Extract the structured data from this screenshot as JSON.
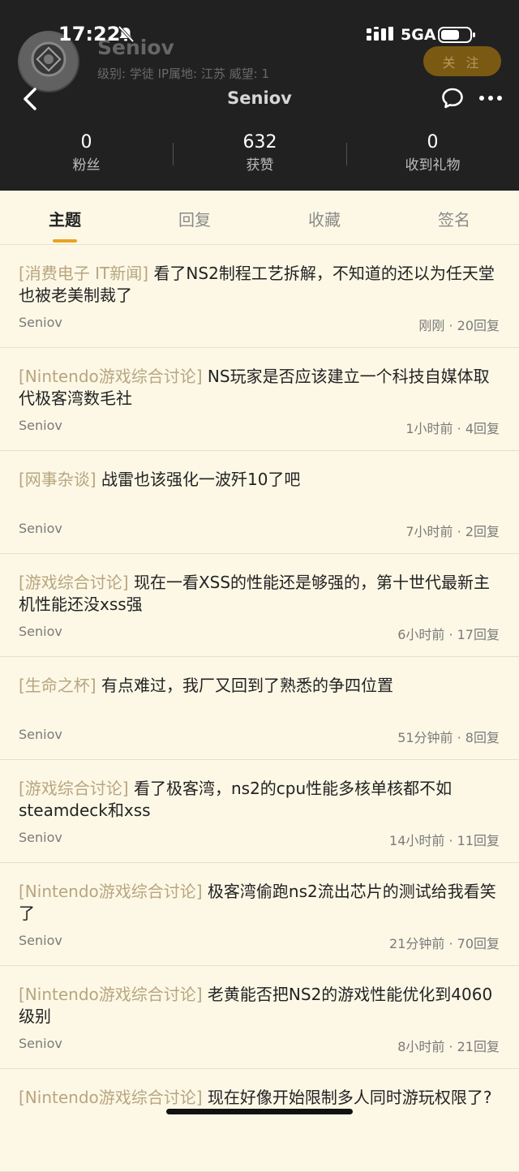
{
  "status_bar": {
    "time": "17:22",
    "network": "5GA"
  },
  "profile": {
    "name": "Seniov",
    "meta": "级别: 学徒  IP属地: 江苏  威望: 1",
    "follow_label": "关 注"
  },
  "nav": {
    "title": "Seniov"
  },
  "stats": [
    {
      "value": "0",
      "label": "粉丝"
    },
    {
      "value": "632",
      "label": "获赞"
    },
    {
      "value": "0",
      "label": "收到礼物"
    }
  ],
  "tabs": [
    {
      "label": "主题",
      "active": true
    },
    {
      "label": "回复",
      "active": false
    },
    {
      "label": "收藏",
      "active": false
    },
    {
      "label": "签名",
      "active": false
    }
  ],
  "posts": [
    {
      "forum": "[消费电子 IT新闻]",
      "title": "看了NS2制程工艺拆解，不知道的还以为任天堂也被老美制裁了",
      "author": "Seniov",
      "meta": "刚刚 · 20回复"
    },
    {
      "forum": "[Nintendo游戏综合讨论]",
      "title": "NS玩家是否应该建立一个科技自媒体取代极客湾数毛社",
      "author": "Seniov",
      "meta": "1小时前 · 4回复"
    },
    {
      "forum": "[网事杂谈]",
      "title": "战雷也该强化一波歼10了吧",
      "author": "Seniov",
      "meta": "7小时前 · 2回复"
    },
    {
      "forum": "[游戏综合讨论]",
      "title": "现在一看XSS的性能还是够强的，第十世代最新主机性能还没xss强",
      "author": "Seniov",
      "meta": "6小时前 · 17回复"
    },
    {
      "forum": "[生命之杯]",
      "title": "有点难过，我厂又回到了熟悉的争四位置",
      "author": "Seniov",
      "meta": "51分钟前 · 8回复"
    },
    {
      "forum": "[游戏综合讨论]",
      "title": "看了极客湾，ns2的cpu性能多核单核都不如steamdeck和xss",
      "author": "Seniov",
      "meta": "14小时前 · 11回复"
    },
    {
      "forum": "[Nintendo游戏综合讨论]",
      "title": "极客湾偷跑ns2流出芯片的测试给我看笑了",
      "author": "Seniov",
      "meta": "21分钟前 · 70回复"
    },
    {
      "forum": "[Nintendo游戏综合讨论]",
      "title": "老黄能否把NS2的游戏性能优化到4060级别",
      "author": "Seniov",
      "meta": "8小时前 · 21回复"
    },
    {
      "forum": "[Nintendo游戏综合讨论]",
      "title": "现在好像开始限制多人同时游玩权限了?",
      "author": "",
      "meta": ""
    }
  ]
}
